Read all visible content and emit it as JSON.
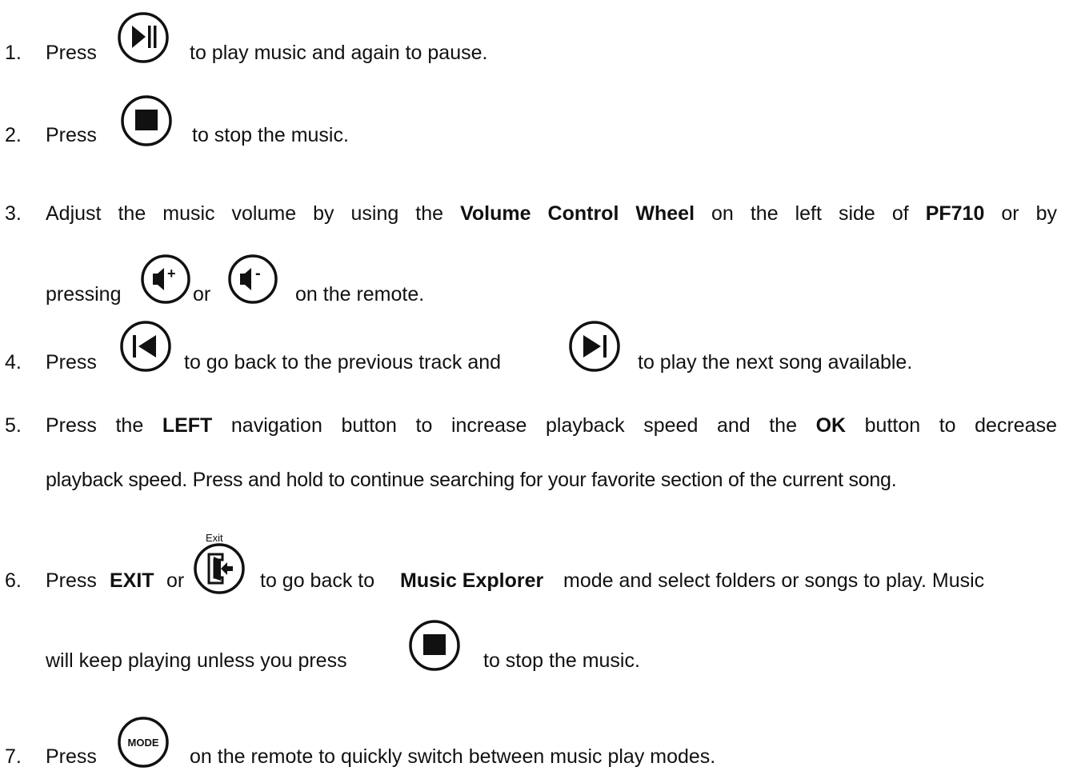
{
  "items": [
    {
      "num": "1.",
      "parts": [
        "Press",
        "to play music and again to pause."
      ],
      "icon": "play-pause-icon"
    },
    {
      "num": "2.",
      "parts": [
        "Press",
        "to stop the music."
      ],
      "icon": "stop-icon"
    },
    {
      "num": "3.",
      "line1": [
        "Adjust the music volume by using the",
        "Volume Control Wheel",
        "on the left side of",
        "PF710",
        "or by"
      ],
      "line2": [
        "pressing",
        "or",
        "on the remote."
      ]
    },
    {
      "num": "4.",
      "parts": [
        "Press",
        "to go back to the previous track and",
        "to play the next song available."
      ]
    },
    {
      "num": "5.",
      "line1": [
        "Press the",
        "LEFT",
        "navigation button to increase playback speed and the",
        "OK",
        "button to decrease"
      ],
      "line2": "playback speed. Press and hold to continue searching for your favorite section of the current song."
    },
    {
      "num": "6.",
      "line1": [
        "Press",
        "EXIT",
        "or",
        "to go back to",
        "Music Explorer",
        "mode and select folders or songs to play. Music"
      ],
      "exit_caption": "Exit",
      "line2": [
        "will keep playing unless you press",
        "to stop the music."
      ]
    },
    {
      "num": "7.",
      "parts": [
        "Press",
        "on the remote to quickly switch between music play modes."
      ],
      "mode_label": "MODE"
    }
  ]
}
